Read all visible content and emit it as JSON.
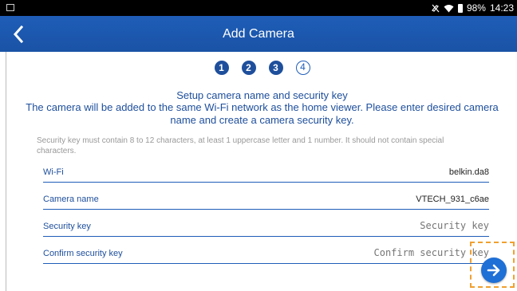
{
  "status_bar": {
    "battery_text": "98%",
    "time": "14:23"
  },
  "header": {
    "title": "Add Camera"
  },
  "steps": [
    "1",
    "2",
    "3",
    "4"
  ],
  "heading": {
    "title": "Setup camera name and security key",
    "subtitle": "The camera will be added to the same Wi-Fi network as the home viewer. Please enter desired camera name and create a camera security key."
  },
  "hint": "Security key must contain 8 to 12 characters, at least 1 uppercase letter and 1 number. It should not contain special characters.",
  "form": {
    "wifi_label": "Wi-Fi",
    "wifi_value": "belkin.da8",
    "camera_name_label": "Camera name",
    "camera_name_value": "VTECH_931_c6ae",
    "security_key_label": "Security key",
    "security_key_placeholder": "Security key",
    "confirm_key_label": "Confirm security key",
    "confirm_key_placeholder": "Confirm security key"
  },
  "colors": {
    "accent": "#1e5db8",
    "highlight": "#f0a030"
  },
  "icons": {
    "back": "back-arrow-icon",
    "next": "arrow-right-circle-icon"
  }
}
